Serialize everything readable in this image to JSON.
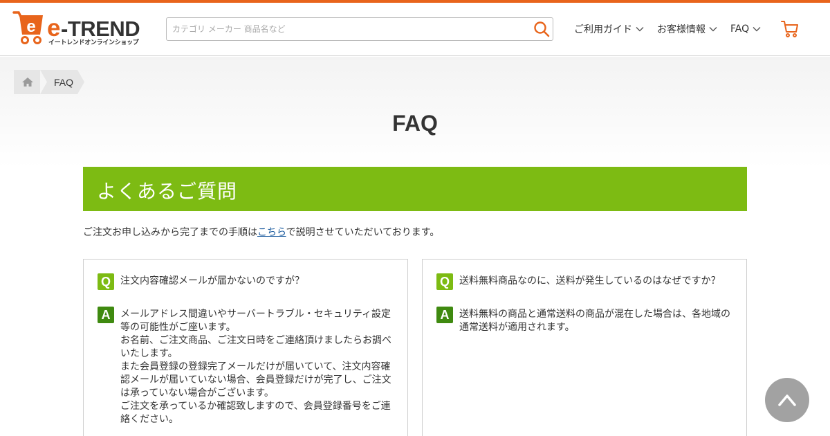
{
  "header": {
    "logo_text": "e-TREND",
    "logo_subtext": "イートレンドオンラインショップ",
    "search_placeholder": "カテゴリ メーカー 商品名など",
    "nav": [
      {
        "label": "ご利用ガイド"
      },
      {
        "label": "お客様情報"
      },
      {
        "label": "FAQ"
      }
    ]
  },
  "breadcrumb": {
    "current": "FAQ"
  },
  "page": {
    "title": "FAQ",
    "section_heading": "よくあるご質問",
    "intro_before": "ご注文お申し込みから完了までの手順は",
    "intro_link": "こちら",
    "intro_after": "で説明させていただいております。"
  },
  "faq": [
    {
      "q_badge": "Q",
      "question": "注文内容確認メールが届かないのですが？",
      "a_badge": "A",
      "answer_lines": [
        "メールアドレス間違いやサーバートラブル・セキュリティ設定",
        "等の可能性がご座います。",
        "お名前、ご注文商品、ご注文日時をご連絡頂けましたらお調べ",
        "いたします。",
        "また会員登録の登録完了メールだけが届いていて、注文内容確",
        "認メールが届いていない場合、会員登録だけが完了し、ご注文",
        "は承っていない場合がございます。",
        "ご注文を承っているか確認致しますので、会員登録番号をご連",
        "絡ください。"
      ]
    },
    {
      "q_badge": "Q",
      "question": "送料無料商品なのに、送料が発生しているのはなぜですか？",
      "a_badge": "A",
      "answer_lines": [
        "送料無料の商品と通常送料の商品が混在した場合は、各地域の",
        "通常送料が適用されます。"
      ]
    }
  ],
  "colors": {
    "brand_orange": "#e8641b",
    "green": "#7dbb13",
    "dark_green": "#3f8a10"
  }
}
